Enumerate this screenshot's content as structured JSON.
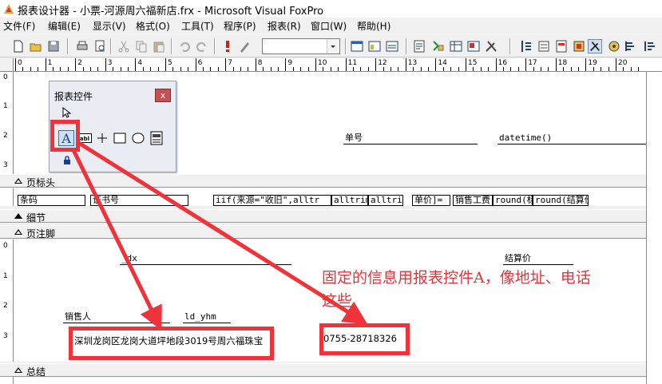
{
  "window": {
    "title": "报表设计器 - 小票-河源周六福新店.frx - Microsoft Visual FoxPro"
  },
  "menu": [
    "文件(F)",
    "编辑(E)",
    "显示(V)",
    "格式(O)",
    "工具(T)",
    "程序(P)",
    "报表(R)",
    "窗口(W)",
    "帮助(H)"
  ],
  "toolbar": {
    "icons": [
      "new-icon",
      "open-icon",
      "save-icon",
      "print-icon",
      "preview-icon",
      "spell-icon",
      "cut-icon",
      "copy-icon",
      "paste-icon",
      "undo-icon",
      "redo-icon",
      "run-icon",
      "modify-icon",
      "command-window-icon",
      "view-window-icon",
      "data-session-icon",
      "report-preview-icon",
      "data-env-icon",
      "table-icon",
      "layout-icon",
      "tools-icon",
      "project-icon",
      "form-icon",
      "report-icon",
      "color-palette-icon",
      "report-controls-icon",
      "layout-toolbar-icon",
      "help-icon"
    ],
    "combo_value": ""
  },
  "ruler": {
    "h_numbers": [
      "0",
      "1",
      "2",
      "3",
      "4",
      "5",
      "6",
      "7",
      "8",
      "9",
      "10",
      "11",
      "12",
      "13",
      "14",
      "15",
      "16",
      "17",
      "18",
      "19",
      "20"
    ],
    "v_top": [
      "0",
      "1",
      "2",
      "3"
    ],
    "v_bottom": [
      "0",
      "1",
      "2",
      "3"
    ]
  },
  "bands": {
    "page_header": "页标头",
    "detail": "细节",
    "page_footer": "页注脚",
    "summary": "总结"
  },
  "header_fields": {
    "order_no": "单号",
    "datetime": "datetime()"
  },
  "detail_fields": {
    "barcode": "条码",
    "cert_no": "证书号",
    "expr1": "iif(来源=\"收旧\",alltr",
    "expr2": "alltrim(",
    "expr3": "alltri",
    "expr4": "单价]=",
    "expr5": "销售工费",
    "expr6": "round(标",
    "expr7": "round(结算价"
  },
  "footer_fields": {
    "dx": "_dx",
    "settle_price": "结算价",
    "salesperson": "销售人",
    "ld_yhm": "ld_yhm",
    "address": "深圳龙岗区龙岗大道坪地段3019号周六福珠宝",
    "phone": "0755-28718326"
  },
  "palette": {
    "title": "报表控件",
    "close": "x",
    "tools": [
      "select-pointer-icon",
      "label-tool-icon",
      "field-tool-icon",
      "line-tool-icon",
      "rectangle-tool-icon",
      "rounded-rectangle-tool-icon",
      "picture-tool-icon",
      "lock-icon"
    ]
  },
  "annotation": {
    "line1": "固定的信息用报表控件A，像地址、电话",
    "line2": "这些",
    "color": "#e8333a"
  }
}
